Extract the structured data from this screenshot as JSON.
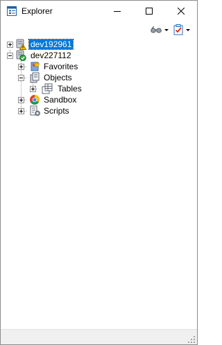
{
  "window": {
    "title": "Explorer"
  },
  "titlebar_buttons": {
    "minimize": "minimize",
    "maximize": "maximize",
    "close": "close"
  },
  "toolbar": {
    "items": [
      {
        "name": "view-options",
        "icon": "glasses-icon",
        "has_dropdown": true
      },
      {
        "name": "checklist",
        "icon": "checklist-icon",
        "has_dropdown": true
      }
    ]
  },
  "tree": {
    "nodes": [
      {
        "label": "dev192961",
        "icon": "server-warning-icon",
        "expanded": false,
        "selected": true
      },
      {
        "label": "dev227112",
        "icon": "server-ok-icon",
        "expanded": true,
        "selected": false,
        "children": [
          {
            "label": "Favorites",
            "icon": "favorites-icon",
            "expanded": false
          },
          {
            "label": "Objects",
            "icon": "objects-icon",
            "expanded": true,
            "children": [
              {
                "label": "Tables",
                "icon": "tables-icon",
                "expanded": false
              }
            ]
          },
          {
            "label": "Sandbox",
            "icon": "sandbox-icon",
            "expanded": false
          },
          {
            "label": "Scripts",
            "icon": "scripts-icon",
            "expanded": false
          }
        ]
      }
    ]
  },
  "colors": {
    "selection": "#0078d7",
    "statusbar": "#f0f0f0"
  }
}
